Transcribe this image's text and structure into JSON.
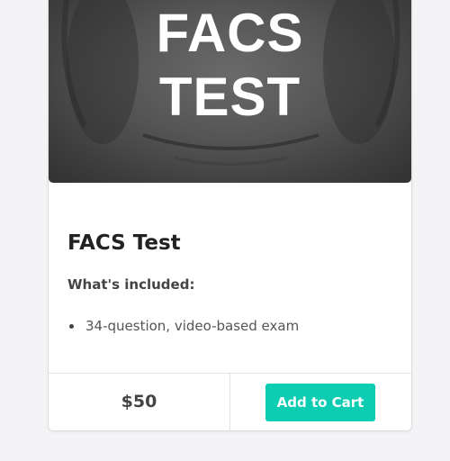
{
  "hero": {
    "line1": "FACS",
    "line2": "TEST"
  },
  "product": {
    "title": "FACS Test",
    "included_label": "What's included:",
    "features": [
      "34-question, video-based exam"
    ],
    "price": "$50",
    "add_to_cart_label": "Add to Cart"
  },
  "colors": {
    "accent": "#0ccdb1",
    "hero_bg": "#555555"
  }
}
